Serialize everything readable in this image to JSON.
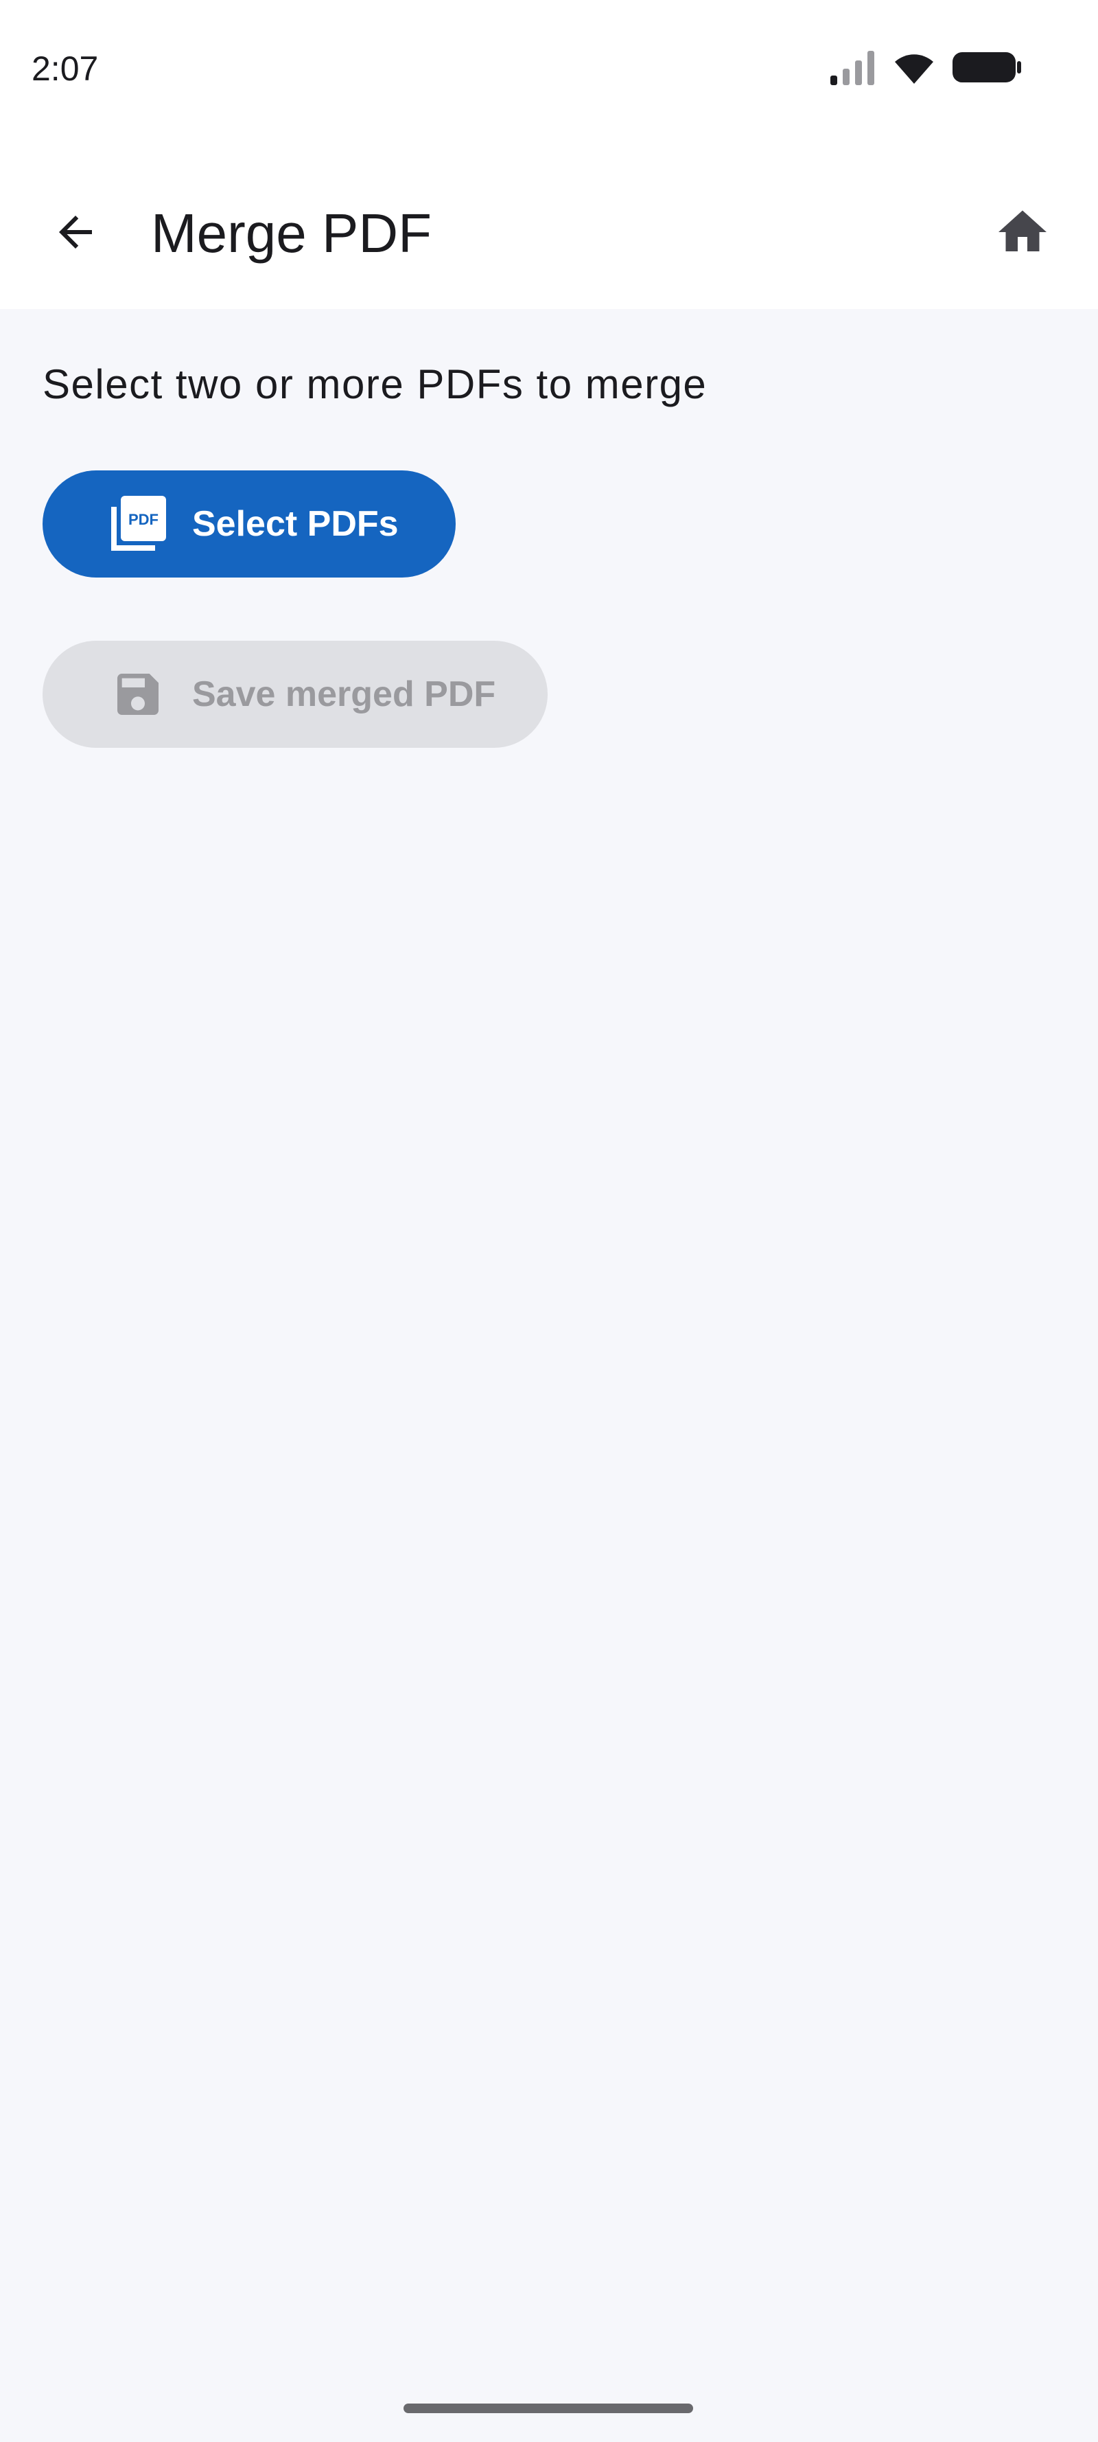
{
  "status_bar": {
    "time": "2:07",
    "icons": [
      "signal-icon",
      "wifi-icon",
      "battery-icon"
    ]
  },
  "app_bar": {
    "title": "Merge PDF",
    "back_icon": "arrow-back-icon",
    "home_icon": "home-icon"
  },
  "main": {
    "instruction": "Select two or more PDFs to merge",
    "select_button": {
      "label": "Select PDFs",
      "icon": "pdf-files-icon",
      "enabled": true
    },
    "save_button": {
      "label": "Save merged PDF",
      "icon": "save-icon",
      "enabled": false
    }
  },
  "colors": {
    "primary": "#1565c0",
    "background": "#f6f7fb",
    "surface": "#ffffff",
    "disabled_bg": "#dfe0e4",
    "disabled_text": "#9a9a9e",
    "text": "#1b1b1f"
  }
}
